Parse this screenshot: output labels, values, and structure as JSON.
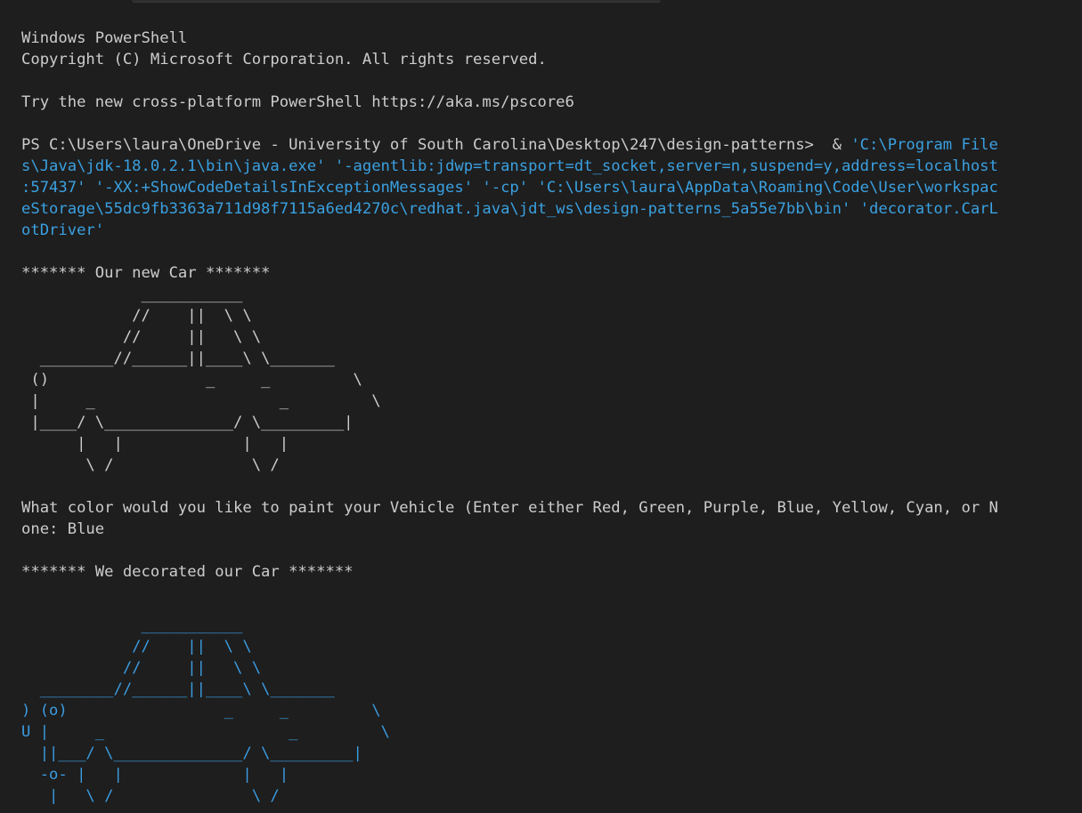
{
  "terminal": {
    "banner": {
      "title": "Windows PowerShell",
      "copyright": "Copyright (C) Microsoft Corporation. All rights reserved.",
      "try_new": "Try the new cross-platform PowerShell https://aka.ms/pscore6"
    },
    "command": {
      "prompt": "PS C:\\Users\\laura\\OneDrive - University of South Carolina\\Desktop\\247\\design-patterns>  & ",
      "line1": "'C:\\Program File",
      "line2": "s\\Java\\jdk-18.0.2.1\\bin\\java.exe' '-agentlib:jdwp=transport=dt_socket,server=n,suspend=y,address=localhost",
      "line3": ":57437' '-XX:+ShowCodeDetailsInExceptionMessages' '-cp' 'C:\\Users\\laura\\AppData\\Roaming\\Code\\User\\workspac",
      "line4": "eStorage\\55dc9fb3363a711d98f7115a6ed4270c\\redhat.java\\jdt_ws\\design-patterns_5a55e7bb\\bin' 'decorator.CarL",
      "line5": "otDriver'"
    },
    "new_car_heading": "******* Our new Car *******",
    "car1": [
      "             ___________",
      "            //    ||  \\ \\",
      "           //     ||   \\ \\",
      "  ________//______||____\\ \\_______",
      " ()                 _     _         \\",
      " |     _                    _         \\",
      " |____/ \\______________/ \\_________|",
      "      |   |             |   |",
      "       \\ /               \\ /"
    ],
    "question_line1": "What color would you like to paint your Vehicle (Enter either Red, Green, Purple, Blue, Yellow, Cyan, or N",
    "question_line2": "one: Blue",
    "decorated_heading": "******* We decorated our Car *******",
    "car2": [
      "             ___________",
      "            //    ||  \\ \\",
      "           //     ||   \\ \\",
      "  ________//______||____\\ \\_______",
      ") (o)                 _     _         \\",
      "U |     _                    _         \\",
      "  ||___/ \\______________/ \\_________|",
      "  -o- |   |             |   |",
      "   |   \\ /               \\ /"
    ],
    "colors": {
      "background": "#1e1e1e",
      "text": "#cccccc",
      "link": "#3aa0e0",
      "blue_car": "#3b9be0"
    }
  }
}
